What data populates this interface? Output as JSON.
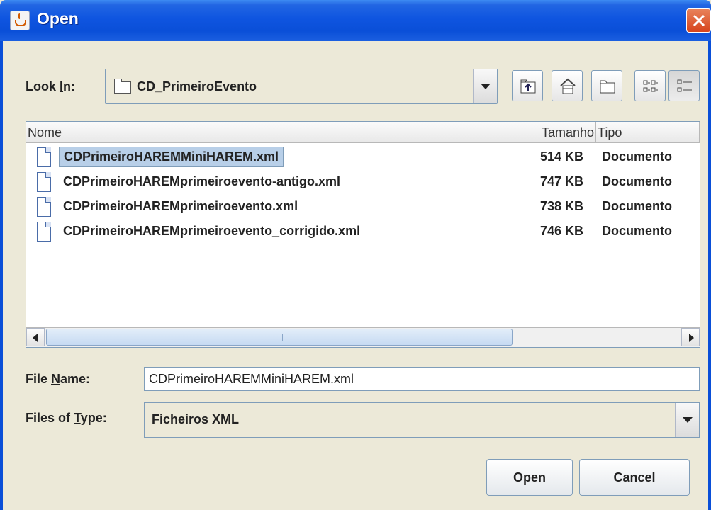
{
  "window": {
    "title": "Open"
  },
  "look_in": {
    "label_pre": "Look ",
    "label_mnemonic": "I",
    "label_post": "n:",
    "value": "CD_PrimeiroEvento"
  },
  "toolbar": {
    "buttons": [
      {
        "icon": "up-one-level-icon"
      },
      {
        "icon": "home-icon"
      },
      {
        "icon": "new-folder-icon"
      },
      {
        "icon": "list-view-icon"
      },
      {
        "icon": "details-view-icon"
      }
    ]
  },
  "file_list": {
    "columns": [
      "Nome",
      "Tamanho",
      "Tipo"
    ],
    "rows": [
      {
        "name": "CDPrimeiroHAREMMiniHAREM.xml",
        "size": "514 KB",
        "type": "Documento",
        "selected": true
      },
      {
        "name": "CDPrimeiroHAREMprimeiroevento-antigo.xml",
        "size": "747 KB",
        "type": "Documento",
        "selected": false
      },
      {
        "name": "CDPrimeiroHAREMprimeiroevento.xml",
        "size": "738 KB",
        "type": "Documento",
        "selected": false
      },
      {
        "name": "CDPrimeiroHAREMprimeiroevento_corrigido.xml",
        "size": "746 KB",
        "type": "Documento",
        "selected": false
      }
    ]
  },
  "file_name": {
    "label_pre": "File ",
    "label_mnemonic": "N",
    "label_post": "ame:",
    "value": "CDPrimeiroHAREMMiniHAREM.xml"
  },
  "file_type": {
    "label_pre": "Files of ",
    "label_mnemonic": "T",
    "label_post": "ype:",
    "value": "Ficheiros XML"
  },
  "buttons": {
    "open": "Open",
    "cancel": "Cancel"
  },
  "colors": {
    "title_bar": "#0a4fd8",
    "selection": "#b8cfe8",
    "border": "#7f9db9",
    "window_bg": "#ece9d8",
    "close": "#d7441c"
  }
}
